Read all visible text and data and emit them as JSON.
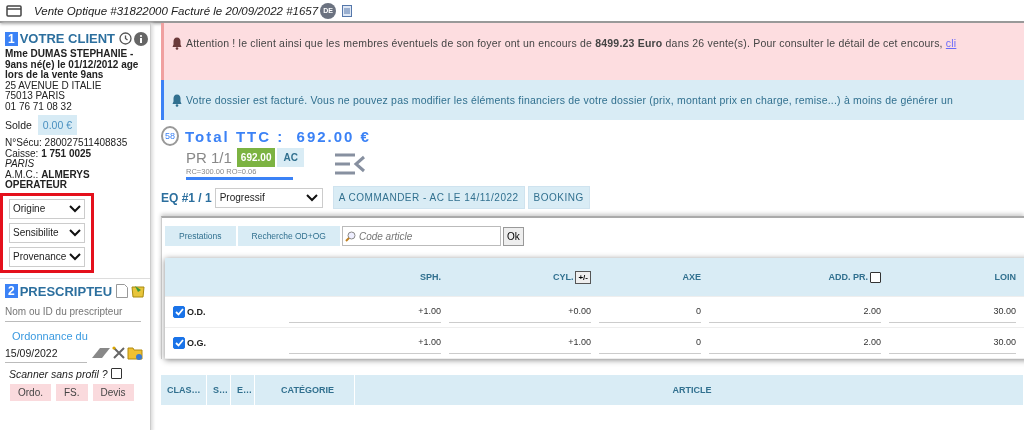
{
  "header": {
    "title": "Vente Optique #31822000 Facturé le 20/09/2022 #1657",
    "avatar": "DE"
  },
  "client": {
    "number": "1",
    "title": "VOTRE CLIENT",
    "lines": [
      {
        "kind": "bold",
        "text": "Mme DUMAS STEPHANIE - 9ans né(e) le 01/12/2012 age lors de la vente 9ans"
      },
      {
        "kind": "plain",
        "text": "25 AVENUE D ITALIE"
      },
      {
        "kind": "plain",
        "text": "75013 PARIS"
      },
      {
        "kind": "plain",
        "text": "01 76 71 08 32"
      }
    ],
    "solde": {
      "label": "Solde",
      "value": "0.00 €"
    },
    "details": [
      {
        "kind": "plain",
        "text": "N°Sécu: 280027511408835"
      },
      {
        "kind": "plain",
        "text": "Caisse: **1 751 0025**"
      },
      {
        "kind": "italic",
        "text": "PARIS"
      },
      {
        "kind": "plain",
        "text": "A.M.C.: **ALMERYS OPERATEUR**"
      }
    ],
    "selects": {
      "highlighted": true,
      "items": [
        "Origine",
        "Sensibilite",
        "Provenance"
      ]
    }
  },
  "prescripteur": {
    "number": "2",
    "title": "PRESCRIPTEU",
    "placeholder": "Nom ou ID du prescripteur",
    "ordonnance_label": "Ordonnance du",
    "date": "15/09/2022",
    "scanner": {
      "label": "Scanner sans profil ?",
      "checked": false
    },
    "buttons": [
      "Ordo.",
      "FS.",
      "Devis"
    ]
  },
  "alerts": [
    {
      "kind": "danger",
      "text": "Attention ! le client ainsi que les membres éventuels de son foyer ont un encours de **8499.23 Euro** dans 26 vente(s). Pour consulter le détail de cet encours, ",
      "link": "cli"
    },
    {
      "kind": "info",
      "text": "Votre dossier est facturé. Vous ne pouvez pas modifier les éléments financiers de votre dossier (prix, montant prix en charge, remise...) à moins de générer un"
    }
  ],
  "total": {
    "badge": "58",
    "label": "Total TTC :  692.00 €"
  },
  "pr": {
    "label": "PR 1/1",
    "amount": "692.00",
    "status": "AC",
    "sub": "RC=300.00 RO=0.06"
  },
  "equipment": {
    "label": "EQ #1 / 1",
    "type": "Progressif",
    "tags": [
      "A COMMANDER - AC LE 14/11/2022",
      "BOOKING"
    ]
  },
  "panel": {
    "buttons": [
      "Prestations",
      "Recherche OD+OG"
    ],
    "placeholder": "Code article",
    "ok": "Ok"
  },
  "prescription": {
    "columns": [
      {
        "kind": "blank"
      },
      {
        "kind": "plain",
        "label": "SPH."
      },
      {
        "kind": "toggle",
        "label": "CYL.",
        "button": "+/-"
      },
      {
        "kind": "plain",
        "label": "AXE"
      },
      {
        "kind": "check",
        "label": "ADD. PR.",
        "checked": false
      },
      {
        "kind": "plain",
        "label": "LOIN"
      }
    ],
    "rows": [
      {
        "eye": "O.D.",
        "checked": true,
        "values": [
          "+1.00",
          "+0.00",
          "0",
          "2.00",
          "30.00"
        ]
      },
      {
        "eye": "O.G.",
        "checked": true,
        "values": [
          "+1.00",
          "+1.00",
          "0",
          "2.00",
          "30.00"
        ]
      }
    ]
  },
  "articles": {
    "columns": [
      "CLAS…",
      "S…",
      "E…",
      "CATÉGORIE",
      "ARTICLE"
    ]
  }
}
